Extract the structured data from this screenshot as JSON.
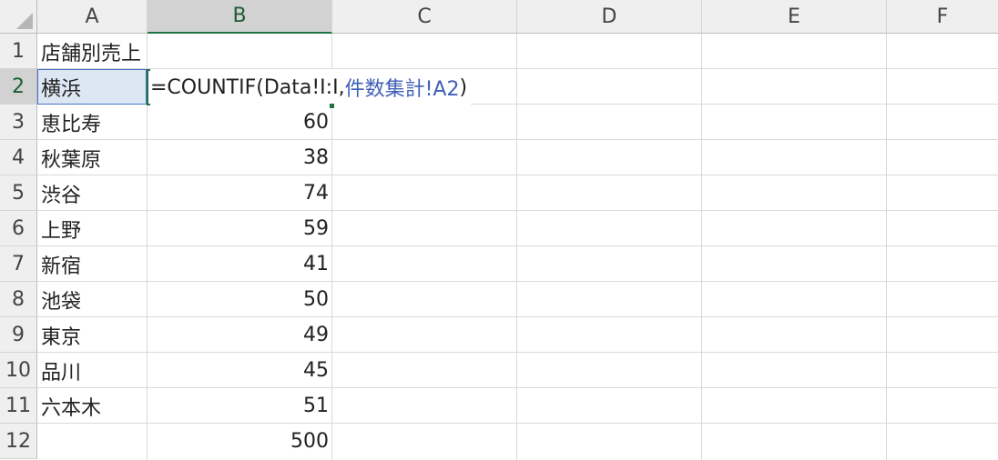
{
  "columns": [
    "A",
    "B",
    "C",
    "D",
    "E",
    "F"
  ],
  "rows": [
    "1",
    "2",
    "3",
    "4",
    "5",
    "6",
    "7",
    "8",
    "9",
    "10",
    "11",
    "12"
  ],
  "selected_cell": "B2",
  "accent_color": "#217346",
  "cells": {
    "A1": "店舗別売上",
    "A2": "横浜",
    "A3": "恵比寿",
    "B3": "60",
    "A4": "秋葉原",
    "B4": "38",
    "A5": "渋谷",
    "B5": "74",
    "A6": "上野",
    "B6": "59",
    "A7": "新宿",
    "B7": "41",
    "A8": "池袋",
    "B8": "50",
    "A9": "東京",
    "B9": "49",
    "A10": "品川",
    "B10": "45",
    "A11": "六本木",
    "B11": "51",
    "B12": "500"
  },
  "editing": {
    "cell": "B2",
    "formula_prefix": "=COUNTIF(Data!I:I,",
    "formula_ref": "件数集計!A2",
    "formula_suffix": ")"
  }
}
